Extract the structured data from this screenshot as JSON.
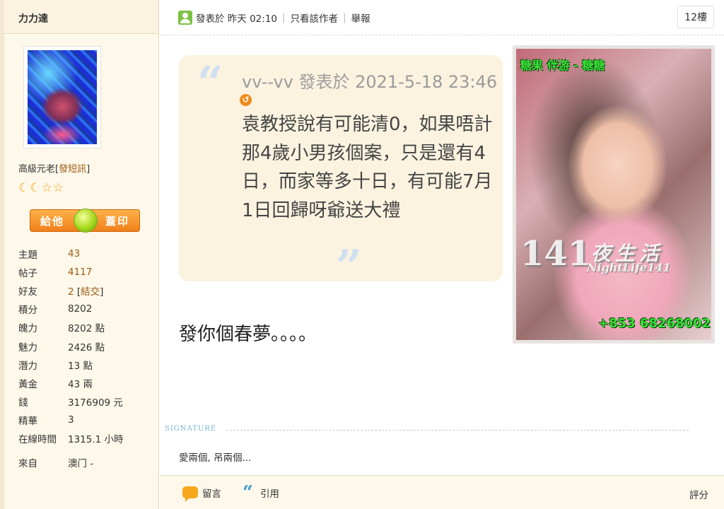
{
  "sidebar": {
    "username": "力力達",
    "rank": "高級元老",
    "rank_link": "發短訊",
    "stars": [
      "☾",
      "☾",
      "☆",
      "☆"
    ],
    "stamp_left": "給他",
    "stamp_right": "蓋印",
    "stats": [
      {
        "label": "主題",
        "value": "43"
      },
      {
        "label": "帖子",
        "value": "4117"
      },
      {
        "label": "好友",
        "value": "2",
        "extra": "結交"
      },
      {
        "label": "積分",
        "value": "8202"
      },
      {
        "label": "魄力",
        "value": "8202 點"
      },
      {
        "label": "魅力",
        "value": "2426 點"
      },
      {
        "label": "潛力",
        "value": "13 點"
      },
      {
        "label": "黃金",
        "value": "43 兩"
      },
      {
        "label": "錢",
        "value": "3176909 元"
      },
      {
        "label": "精華",
        "value": "3"
      },
      {
        "label": "在線時間",
        "value": "1315.1 小時"
      },
      {
        "label": "來自",
        "value": "澳门 -"
      }
    ]
  },
  "post": {
    "posted_label": "發表於",
    "posted_time": "昨天 02:10",
    "only_author": "只看該作者",
    "report": "舉報",
    "floor": "12樓",
    "quote_author": "vv--vv 發表於 2021-5-18 23:46",
    "quote_text": "袁教授說有可能清0，如果唔計那4歲小男孩個案，只是還有4日，而家等多十日，有可能7月1日回歸呀爺送大禮",
    "body": "發你個春夢。。。。",
    "signature_label": "SIGNATURE",
    "signature": "愛兩個, 吊兩個..."
  },
  "promo": {
    "top": "糖果 伴游 - 糖糖",
    "number": "141",
    "cn": "夜生活",
    "en": "NightLife141",
    "phone": "+853 68268002"
  },
  "footer": {
    "reply": "留言",
    "quote": "引用",
    "rate": "評分"
  }
}
